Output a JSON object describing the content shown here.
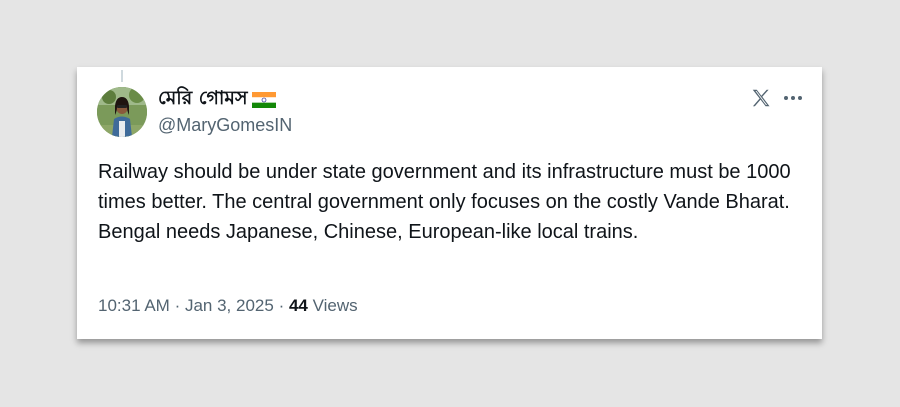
{
  "author": {
    "display_name": "মেরি গোমস",
    "handle": "@MaryGomesIN",
    "flag_icon": "india-flag-icon",
    "avatar_icon": "profile-photo"
  },
  "tweet": {
    "text": "Railway should be under state government and its infrastructure must be 1000 times better. The central government only focuses on the costly Vande Bharat. Bengal needs Japanese, Chinese, European-like local trains."
  },
  "meta": {
    "time": "10:31 AM",
    "separator": "·",
    "date": "Jan 3, 2025",
    "views_count": "44",
    "views_label": "Views"
  },
  "icons": {
    "logo": "x-logo-icon",
    "more": "more-options-icon"
  },
  "colors": {
    "background": "#e5e5e5",
    "card": "#ffffff",
    "text_primary": "#0f1419",
    "text_secondary": "#536471",
    "icon": "#536471"
  }
}
